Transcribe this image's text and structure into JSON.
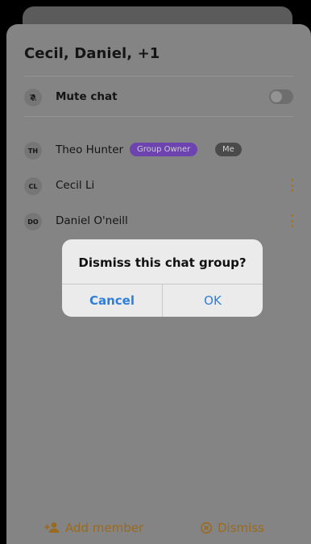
{
  "header": {
    "title": "Cecil, Daniel, +1"
  },
  "mute": {
    "label": "Mute chat",
    "enabled": false,
    "icon": "bell-slash-icon"
  },
  "members": [
    {
      "initials": "TH",
      "name": "Theo Hunter",
      "badges": [
        "Group Owner",
        "Me"
      ]
    },
    {
      "initials": "CL",
      "name": "Cecil Li",
      "menu_icon": "more-vertical-icon"
    },
    {
      "initials": "DO",
      "name": "Daniel O'neill",
      "menu_icon": "more-vertical-icon"
    }
  ],
  "dialog": {
    "title": "Dismiss this chat group?",
    "cancel_label": "Cancel",
    "ok_label": "OK"
  },
  "footer": {
    "add_member_label": "Add member",
    "add_member_icon": "add-person-icon",
    "dismiss_label": "Dismiss",
    "dismiss_icon": "circle-x-icon"
  },
  "colors": {
    "accent": "#9a6a1e",
    "owner_badge": "#6d43b0",
    "me_badge": "#4a4a4a",
    "dialog_link": "#2f7ed8"
  }
}
